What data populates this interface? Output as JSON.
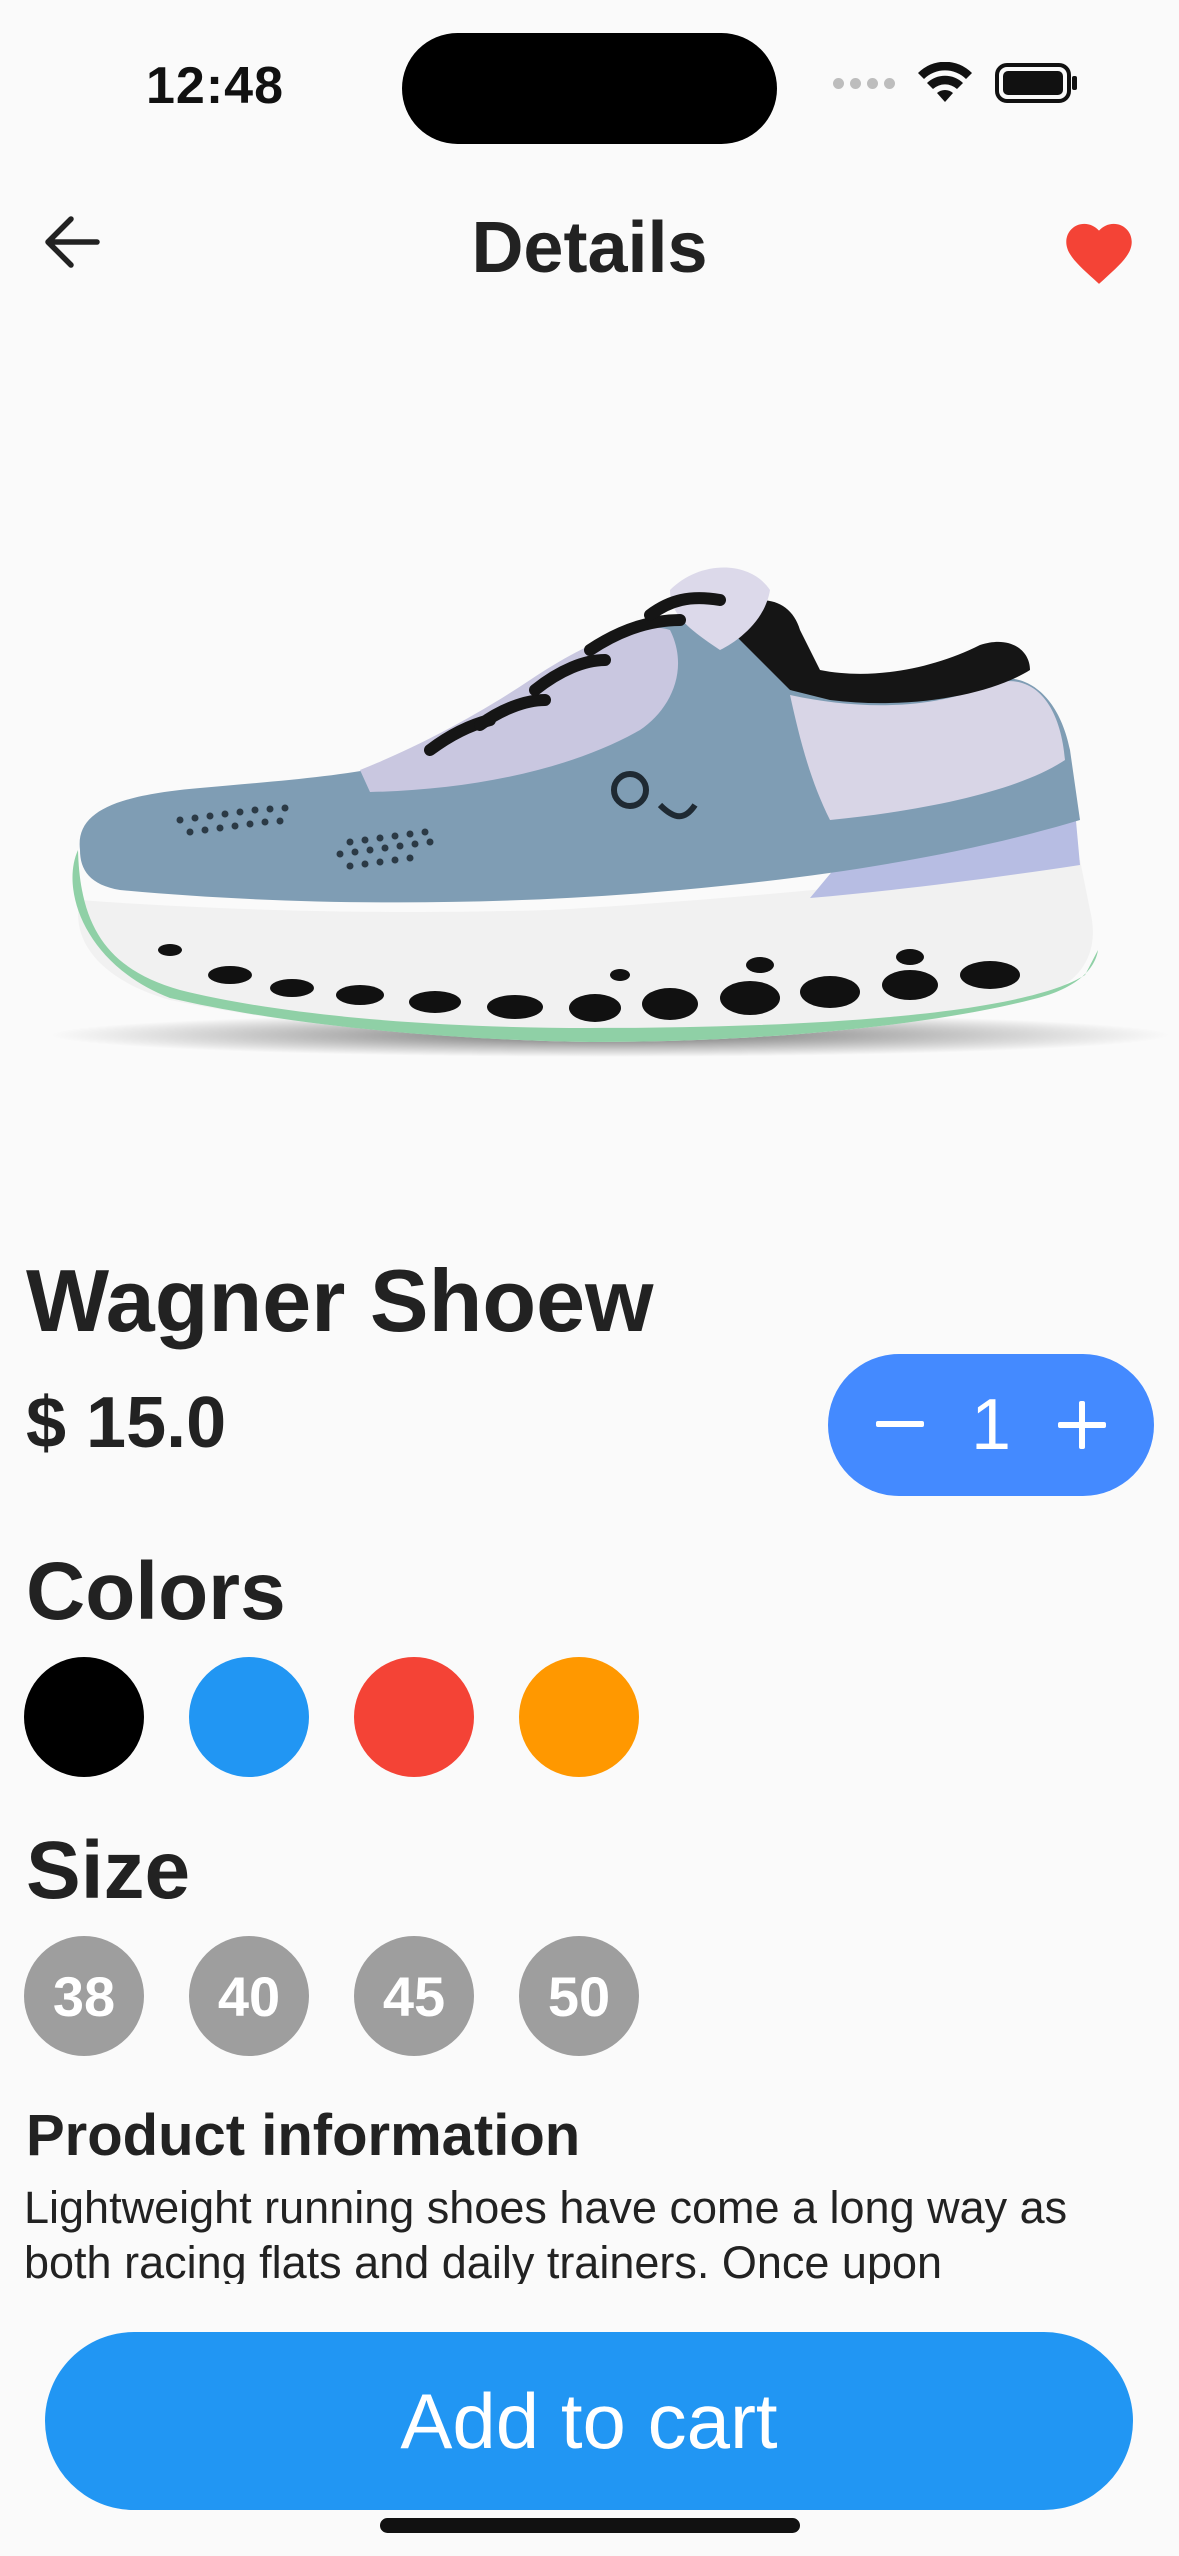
{
  "status_bar": {
    "time": "12:48"
  },
  "app_bar": {
    "title": "Details",
    "back_icon": "arrow-left-icon",
    "favorite_icon": "heart-icon",
    "favorite_color": "#f44336"
  },
  "product": {
    "name": "Wagner Shoew",
    "price": "$ 15.0",
    "image_icon": "running-shoe-image"
  },
  "quantity": {
    "value": "1",
    "decrement_icon": "minus-icon",
    "increment_icon": "plus-icon",
    "color": "#448aff"
  },
  "colors": {
    "heading": "Colors",
    "options": [
      {
        "name": "black",
        "hex": "#000000"
      },
      {
        "name": "blue",
        "hex": "#2196f3"
      },
      {
        "name": "red",
        "hex": "#f44336"
      },
      {
        "name": "orange",
        "hex": "#ff9800"
      }
    ]
  },
  "sizes": {
    "heading": "Size",
    "options": [
      "38",
      "40",
      "45",
      "50"
    ]
  },
  "info": {
    "heading": "Product information",
    "text": "Lightweight running shoes have come a long way as both racing flats and daily trainers. Once upon"
  },
  "cart_button": {
    "label": "Add to cart",
    "color": "#2196f3"
  }
}
